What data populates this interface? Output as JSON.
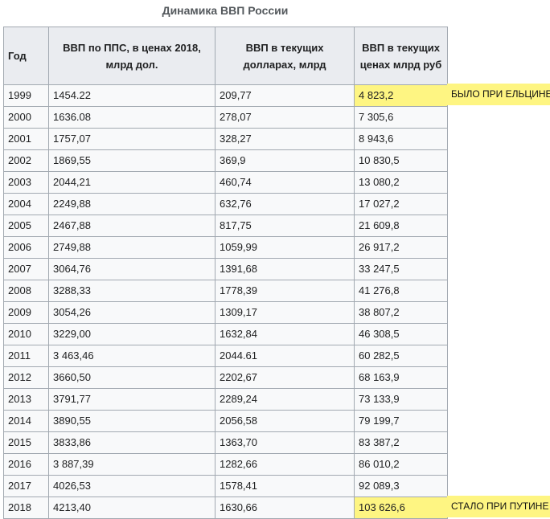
{
  "caption": "Динамика ВВП России",
  "headers": {
    "year": "Год",
    "ppp": "ВВП по ППС, в ценах 2018, млрд дол.",
    "usd": "ВВП в текущих долларах, млрд",
    "rub": "ВВП в текущих ценах млрд руб"
  },
  "rows": [
    {
      "year": "1999",
      "ppp": "1454.22",
      "usd": "209,77",
      "rub": "4 823,2"
    },
    {
      "year": "2000",
      "ppp": "1636.08",
      "usd": "278,07",
      "rub": "7 305,6"
    },
    {
      "year": "2001",
      "ppp": "1757,07",
      "usd": "328,27",
      "rub": "8 943,6"
    },
    {
      "year": "2002",
      "ppp": "1869,55",
      "usd": "369,9",
      "rub": "10 830,5"
    },
    {
      "year": "2003",
      "ppp": "2044,21",
      "usd": "460,74",
      "rub": "13 080,2"
    },
    {
      "year": "2004",
      "ppp": "2249,88",
      "usd": "632,76",
      "rub": "17 027,2"
    },
    {
      "year": "2005",
      "ppp": "2467,88",
      "usd": "817,75",
      "rub": "21 609,8"
    },
    {
      "year": "2006",
      "ppp": "2749,88",
      "usd": "1059,99",
      "rub": "26 917,2"
    },
    {
      "year": "2007",
      "ppp": "3064,76",
      "usd": "1391,68",
      "rub": "33 247,5"
    },
    {
      "year": "2008",
      "ppp": "3288,33",
      "usd": "1778,39",
      "rub": "41 276,8"
    },
    {
      "year": "2009",
      "ppp": "3054,26",
      "usd": "1309,17",
      "rub": "38 807,2"
    },
    {
      "year": "2010",
      "ppp": "3229,00",
      "usd": "1632,84",
      "rub": "46 308,5"
    },
    {
      "year": "2011",
      "ppp": "3 463,46",
      "usd": "2044.61",
      "rub": "60 282,5"
    },
    {
      "year": "2012",
      "ppp": "3660,50",
      "usd": "2202,67",
      "rub": "68 163,9"
    },
    {
      "year": "2013",
      "ppp": "3791,77",
      "usd": "2289,24",
      "rub": "73 133,9"
    },
    {
      "year": "2014",
      "ppp": "3890,55",
      "usd": "2056,58",
      "rub": "79 199,7"
    },
    {
      "year": "2015",
      "ppp": "3833,86",
      "usd": "1363,70",
      "rub": "83 387,2"
    },
    {
      "year": "2016",
      "ppp": "3 887,39",
      "usd": "1282,66",
      "rub": "86 010,2"
    },
    {
      "year": "2017",
      "ppp": "4026,53",
      "usd": "1578,41",
      "rub": "92 089,3"
    },
    {
      "year": "2018",
      "ppp": "4213,40",
      "usd": "1630,66",
      "rub": "103 626,6"
    }
  ],
  "notes": {
    "top": "БЫЛО ПРИ ЕЛЬЦИНЕ",
    "bottom": "СТАЛО ПРИ ПУТИНЕ"
  },
  "colors": {
    "highlight": "#fef582",
    "header_bg": "#eaecf0",
    "cell_bg": "#f8f9fa",
    "border": "#a2a9b1"
  }
}
